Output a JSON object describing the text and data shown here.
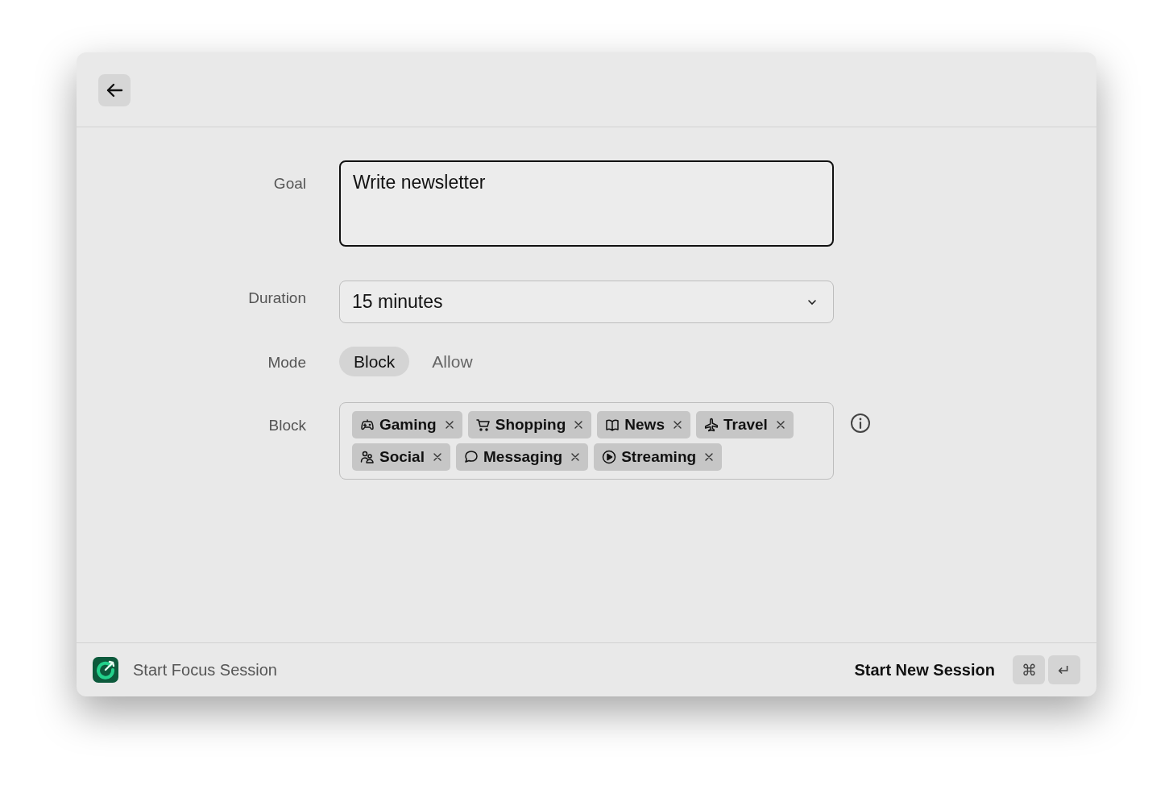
{
  "goal": {
    "label": "Goal",
    "value": "Write newsletter"
  },
  "duration": {
    "label": "Duration",
    "value": "15 minutes"
  },
  "mode": {
    "label": "Mode",
    "options": [
      {
        "label": "Block",
        "selected": true
      },
      {
        "label": "Allow",
        "selected": false
      }
    ]
  },
  "block": {
    "label": "Block",
    "tags": [
      {
        "kind": "gaming",
        "label": "Gaming"
      },
      {
        "kind": "shopping",
        "label": "Shopping"
      },
      {
        "kind": "news",
        "label": "News"
      },
      {
        "kind": "travel",
        "label": "Travel"
      },
      {
        "kind": "social",
        "label": "Social"
      },
      {
        "kind": "messaging",
        "label": "Messaging"
      },
      {
        "kind": "streaming",
        "label": "Streaming"
      }
    ]
  },
  "footer": {
    "title": "Start Focus Session",
    "action": "Start New Session",
    "keys": [
      "⌘",
      "↵"
    ]
  }
}
